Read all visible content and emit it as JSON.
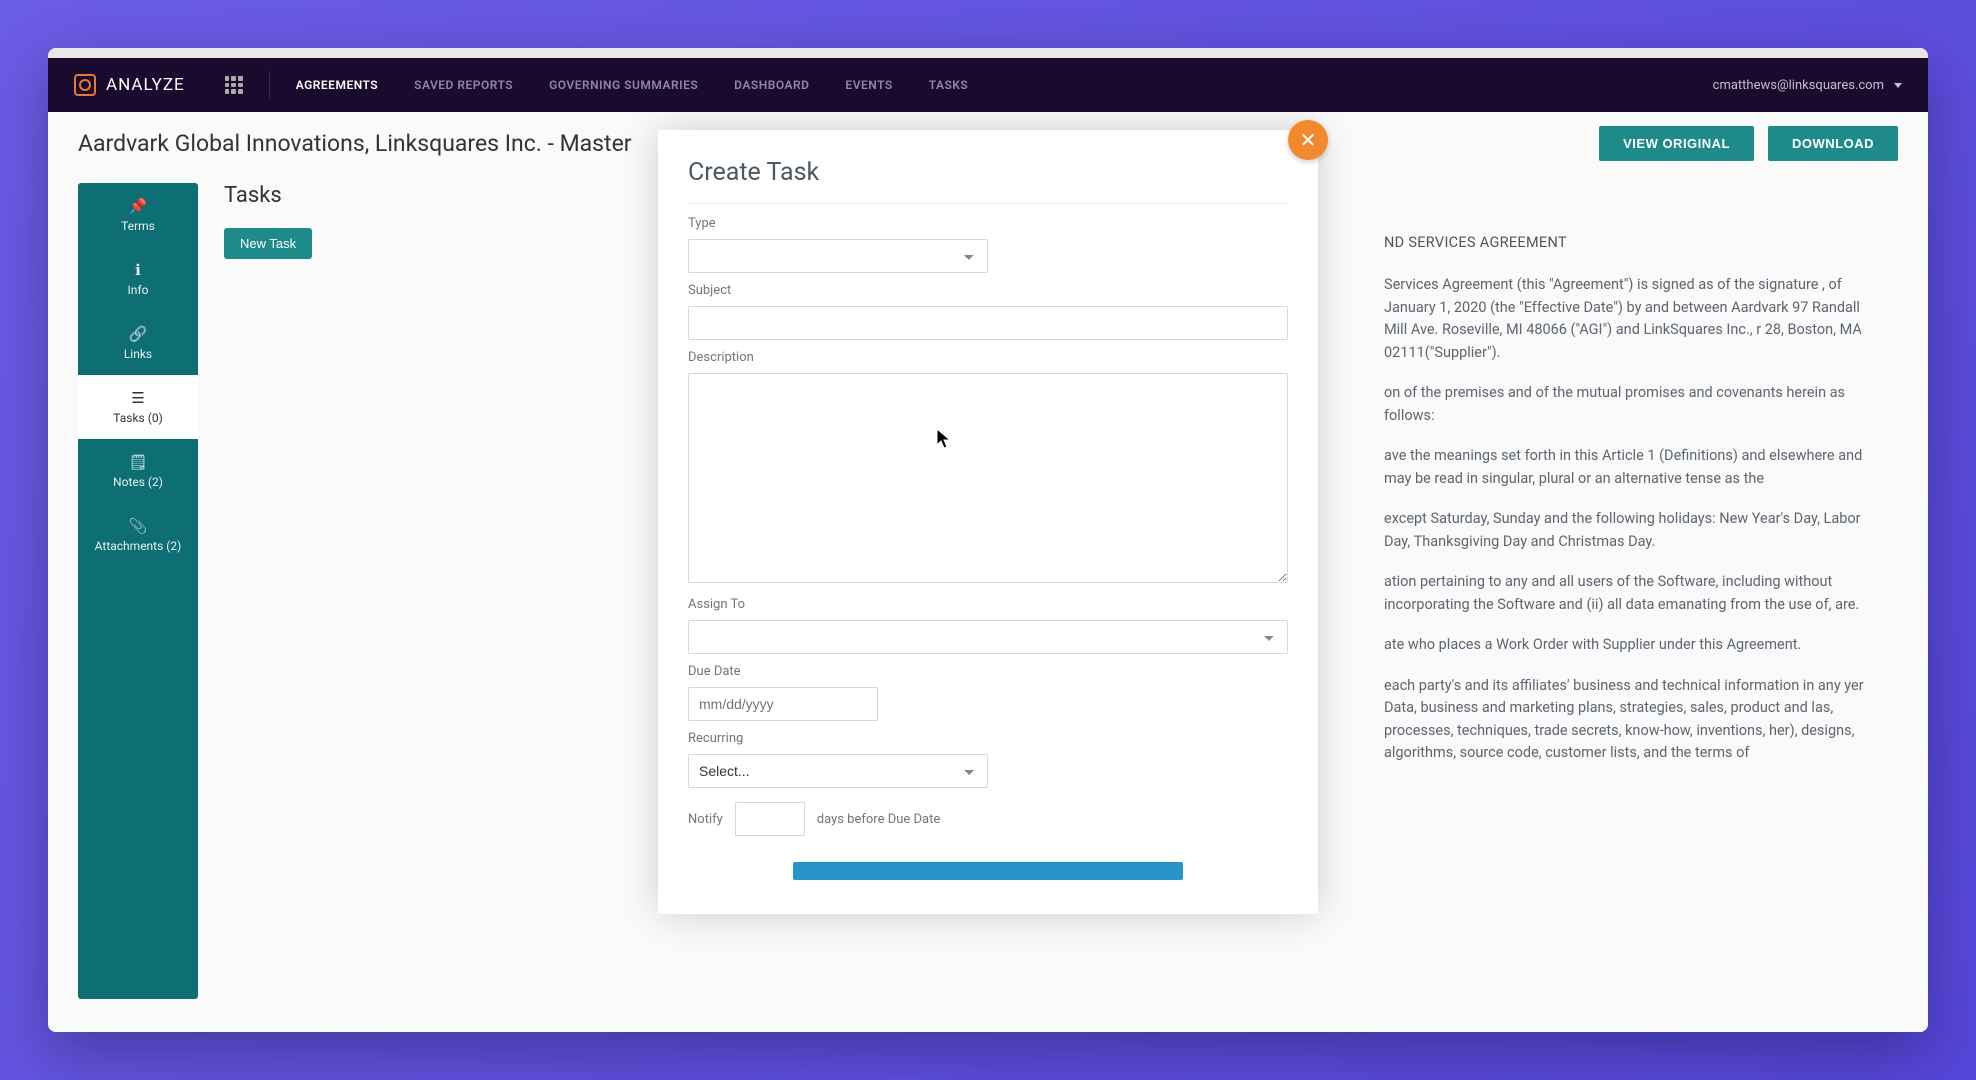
{
  "brand": "ANALYZE",
  "nav": {
    "items": [
      {
        "label": "AGREEMENTS",
        "active": true
      },
      {
        "label": "SAVED REPORTS",
        "active": false
      },
      {
        "label": "GOVERNING SUMMARIES",
        "active": false
      },
      {
        "label": "DASHBOARD",
        "active": false
      },
      {
        "label": "EVENTS",
        "active": false
      },
      {
        "label": "TASKS",
        "active": false
      }
    ],
    "user_email": "cmatthews@linksquares.com"
  },
  "page": {
    "title": "Aardvark Global Innovations, Linksquares Inc. - Master",
    "view_original": "VIEW ORIGINAL",
    "download": "DOWNLOAD"
  },
  "sidebar": [
    {
      "icon": "📌",
      "label": "Terms",
      "name": "terms"
    },
    {
      "icon": "ℹ",
      "label": "Info",
      "name": "info"
    },
    {
      "icon": "🔗",
      "label": "Links",
      "name": "links"
    },
    {
      "icon": "☰",
      "label": "Tasks (0)",
      "name": "tasks",
      "active": true
    },
    {
      "icon": "🗒",
      "label": "Notes (2)",
      "name": "notes"
    },
    {
      "icon": "📎",
      "label": "Attachments (2)",
      "name": "attachments"
    }
  ],
  "tasks_section": {
    "heading": "Tasks",
    "new_task": "New Task"
  },
  "modal": {
    "title": "Create Task",
    "labels": {
      "type": "Type",
      "subject": "Subject",
      "description": "Description",
      "assign_to": "Assign To",
      "due_date": "Due Date",
      "recurring": "Recurring",
      "notify": "Notify",
      "notify_suffix": "days before Due Date"
    },
    "placeholders": {
      "due_date": "mm/dd/yyyy",
      "recurring": "Select..."
    },
    "values": {
      "type": "",
      "subject": "",
      "description": "",
      "assign_to": "",
      "due_date": "",
      "recurring": "",
      "notify_days": ""
    }
  },
  "document": {
    "heading_fragment": "ND SERVICES AGREEMENT",
    "p1": "Services Agreement (this \"Agreement\") is signed as of the signature , of January 1, 2020 (the \"Effective Date\") by and between Aardvark 97 Randall Mill Ave. Roseville, MI 48066 (\"AGI\") and LinkSquares Inc., r 28, Boston, MA 02111(\"Supplier\").",
    "p2": "on of the premises and of the mutual promises and covenants herein as follows:",
    "p3": "ave the meanings set forth in this Article 1 (Definitions) and elsewhere and may be read in singular, plural or an alternative tense as the",
    "p4": "except Saturday, Sunday and the following holidays: New Year's Day, Labor Day, Thanksgiving Day and Christmas Day.",
    "p5": "ation pertaining to any and all users of the Software, including without incorporating the Software and (ii) all data emanating from the use of, are.",
    "p6": "ate who places a Work Order with Supplier under this Agreement.",
    "p7": "each party's and its affiliates' business and technical information in any yer Data, business and marketing plans, strategies, sales, product and las, processes, techniques, trade secrets, know-how, inventions, her), designs, algorithms, source code, customer lists, and the terms of"
  }
}
